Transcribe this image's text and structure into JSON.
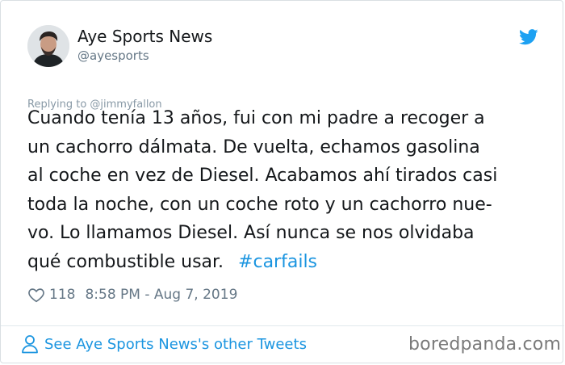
{
  "author": {
    "name": "Aye Sports News",
    "handle": "@ayesports"
  },
  "icons": {
    "twitter": "twitter-bird-icon",
    "heart": "heart-outline-icon",
    "person": "person-outline-icon"
  },
  "colors": {
    "link": "#1b95e0",
    "text": "#14171a",
    "muted": "#657786"
  },
  "tweet": {
    "replying_to": "Replying to @jimmyfallon",
    "lines": [
      "Cuando tenía 13 años, fui con mi padre a recoger a",
      "un cachorro dálmata. De vuelta, echamos gasolina",
      "al coche en vez de Diesel. Acabamos ahí tirados casi",
      "toda la noche, con un coche roto y un cachorro nue-",
      "vo. Lo llamamos Diesel. Así nunca se nos olvidaba",
      "qué combustible usar."
    ],
    "hashtag": "#carfails",
    "likes": "118",
    "timestamp": "8:58 PM - Aug 7, 2019"
  },
  "footer": {
    "see_more": "See Aye Sports News's other Tweets",
    "watermark": "boredpanda.com"
  }
}
